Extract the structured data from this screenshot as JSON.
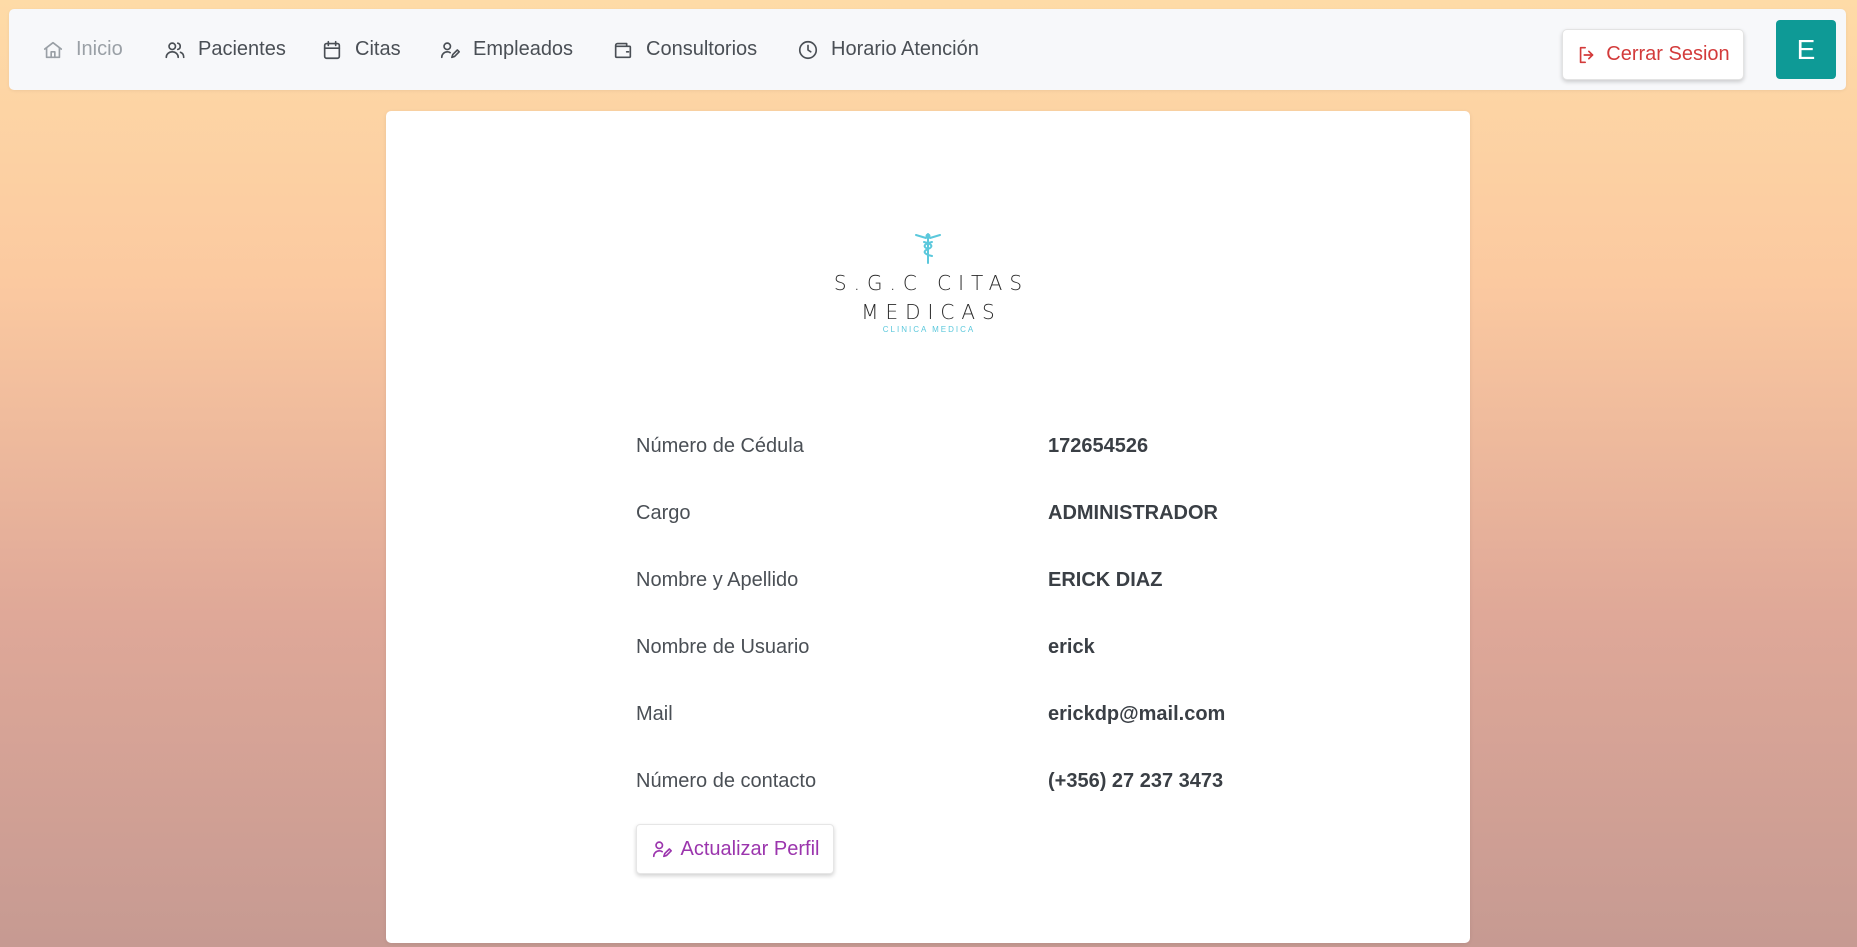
{
  "nav": {
    "items": [
      {
        "label": "Inicio",
        "icon": "home-icon"
      },
      {
        "label": "Pacientes",
        "icon": "users-icon"
      },
      {
        "label": "Citas",
        "icon": "calendar-icon"
      },
      {
        "label": "Empleados",
        "icon": "user-edit-icon"
      },
      {
        "label": "Consultorios",
        "icon": "wallet-icon"
      },
      {
        "label": "Horario Atención",
        "icon": "clock-icon"
      }
    ],
    "logout_label": "Cerrar Sesion",
    "avatar_initial": "E"
  },
  "logo": {
    "line1": "S.G.C CITAS",
    "line2": "MEDICAS",
    "subtitle": "CLINICA MEDICA"
  },
  "profile": {
    "fields": [
      {
        "label": "Número de Cédula",
        "value": "172654526"
      },
      {
        "label": "Cargo",
        "value": "ADMINISTRADOR"
      },
      {
        "label": "Nombre y Apellido",
        "value": "ERICK DIAZ"
      },
      {
        "label": "Nombre de Usuario",
        "value": "erick"
      },
      {
        "label": "Mail",
        "value": "erickdp@mail.com"
      },
      {
        "label": "Número de contacto",
        "value": "(+356) 27 237 3473"
      }
    ],
    "update_label": "Actualizar Perfil"
  },
  "colors": {
    "accent_teal": "#0e9a96",
    "logout_red": "#d33b3b",
    "update_purple": "#9b35ad",
    "logo_cyan": "#5bc8dc"
  }
}
